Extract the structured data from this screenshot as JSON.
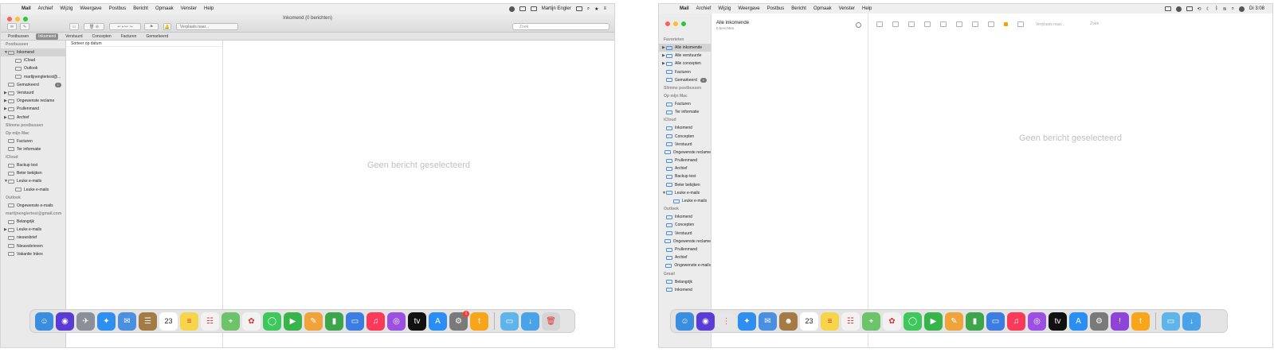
{
  "left": {
    "menubar": [
      "Mail",
      "Archief",
      "Wijzig",
      "Weergave",
      "Postbus",
      "Bericht",
      "Opmaak",
      "Venster",
      "Help"
    ],
    "user": "Martijn Engler",
    "window_title": "Inkomend (0 berichten)",
    "search_placeholder": "Zoek",
    "move_placeholder": "Verplaats naar...",
    "favorites": [
      "Postbussen",
      "Inkomend",
      "Verstuurd",
      "Concepten",
      "Facturen",
      "Gemarkeerd"
    ],
    "sort_label": "Sorteer op datum",
    "no_selection": "Geen bericht geselecteerd",
    "sidebar": [
      {
        "type": "head",
        "label": "Postbussen"
      },
      {
        "type": "row",
        "label": "Inkomend",
        "indent": 0,
        "disc": "▼",
        "selected": true
      },
      {
        "type": "row",
        "label": "iCloud",
        "indent": 1,
        "disc": ""
      },
      {
        "type": "row",
        "label": "Outlook",
        "indent": 1,
        "disc": ""
      },
      {
        "type": "row",
        "label": "martijnenglertest@...",
        "indent": 1,
        "disc": ""
      },
      {
        "type": "row",
        "label": "Gemarkeerd",
        "indent": 0,
        "disc": "",
        "badge": "1"
      },
      {
        "type": "row",
        "label": "Verstuurd",
        "indent": 0,
        "disc": "▶"
      },
      {
        "type": "row",
        "label": "Ongewenste reclame",
        "indent": 0,
        "disc": "▶"
      },
      {
        "type": "row",
        "label": "Prullenmand",
        "indent": 0,
        "disc": "▶"
      },
      {
        "type": "row",
        "label": "Archief",
        "indent": 0,
        "disc": "▶"
      },
      {
        "type": "head",
        "label": "Slimme postbussen"
      },
      {
        "type": "head",
        "label": "Op mijn Mac"
      },
      {
        "type": "row",
        "label": "Facturen",
        "indent": 0,
        "disc": ""
      },
      {
        "type": "row",
        "label": "Ter informatie",
        "indent": 0,
        "disc": ""
      },
      {
        "type": "head",
        "label": "iCloud"
      },
      {
        "type": "row",
        "label": "Backup test",
        "indent": 0,
        "disc": ""
      },
      {
        "type": "row",
        "label": "Beter bekijken",
        "indent": 0,
        "disc": ""
      },
      {
        "type": "row",
        "label": "Leuke e-mails",
        "indent": 0,
        "disc": "▼"
      },
      {
        "type": "row",
        "label": "Leuke e-mails",
        "indent": 1,
        "disc": ""
      },
      {
        "type": "head",
        "label": "Outlook"
      },
      {
        "type": "row",
        "label": "Ongewenste e-mails",
        "indent": 0,
        "disc": ""
      },
      {
        "type": "head",
        "label": "martijnenglertest@gmail.com"
      },
      {
        "type": "row",
        "label": "Belangrijk",
        "indent": 0,
        "disc": ""
      },
      {
        "type": "row",
        "label": "Leuke e-mails",
        "indent": 0,
        "disc": "▶"
      },
      {
        "type": "row",
        "label": "nieuwsbrief",
        "indent": 0,
        "disc": ""
      },
      {
        "type": "row",
        "label": "Nieuwsbrieven",
        "indent": 0,
        "disc": ""
      },
      {
        "type": "row",
        "label": "Vakantie Inbox",
        "indent": 0,
        "disc": ""
      }
    ],
    "dock": [
      {
        "name": "finder",
        "color": "#3b8de0",
        "glyph": "☺"
      },
      {
        "name": "siri",
        "color": "#5a3bd6",
        "glyph": "◉"
      },
      {
        "name": "launchpad",
        "color": "#8a8f99",
        "glyph": "✈"
      },
      {
        "name": "safari",
        "color": "#2f8ff0",
        "glyph": "✦"
      },
      {
        "name": "mail",
        "color": "#4a8fe0",
        "glyph": "✉"
      },
      {
        "name": "contacts",
        "color": "#a57b45",
        "glyph": "☰"
      },
      {
        "name": "calendar",
        "color": "#ffffff",
        "glyph": "23"
      },
      {
        "name": "notes",
        "color": "#f7d54a",
        "glyph": "≡"
      },
      {
        "name": "reminders",
        "color": "#f2f2f2",
        "glyph": "☷"
      },
      {
        "name": "maps",
        "color": "#6cc36a",
        "glyph": "⌖"
      },
      {
        "name": "photos",
        "color": "#f2f2f2",
        "glyph": "✿"
      },
      {
        "name": "messages",
        "color": "#3ec75a",
        "glyph": "◯"
      },
      {
        "name": "facetime",
        "color": "#38b54a",
        "glyph": "▶"
      },
      {
        "name": "freeform",
        "color": "#f0a33a",
        "glyph": "✎"
      },
      {
        "name": "numbers",
        "color": "#3da64b",
        "glyph": "▮"
      },
      {
        "name": "keynote",
        "color": "#3b7de0",
        "glyph": "▭"
      },
      {
        "name": "music",
        "color": "#fb3958",
        "glyph": "♫"
      },
      {
        "name": "podcasts",
        "color": "#9b4fe3",
        "glyph": "◎"
      },
      {
        "name": "tv",
        "color": "#111111",
        "glyph": "tv"
      },
      {
        "name": "app-store",
        "color": "#2a8ef5",
        "glyph": "A"
      },
      {
        "name": "system-preferences",
        "color": "#7a7a7a",
        "glyph": "⚙",
        "badge": "1"
      },
      {
        "name": "tips",
        "color": "#f9a51a",
        "glyph": "t"
      },
      {
        "name": "sep"
      },
      {
        "name": "folder-apps",
        "color": "#5fb4ea",
        "glyph": "▭"
      },
      {
        "name": "folder-downloads",
        "color": "#4aa3e8",
        "glyph": "↓"
      },
      {
        "name": "trash",
        "color": "#d5d5d5",
        "glyph": "🗑"
      }
    ]
  },
  "right": {
    "menubar": [
      "Mail",
      "Archief",
      "Wijzig",
      "Weergave",
      "Postbus",
      "Bericht",
      "Opmaak",
      "Venster",
      "Help"
    ],
    "clock": "Di 3:08",
    "list_title": "Alle inkomende",
    "list_subtitle": "0 berichten",
    "move_placeholder": "Verplaats naar...",
    "search_placeholder": "Zoek",
    "no_selection": "Geen bericht geselecteerd",
    "sidebar": [
      {
        "type": "head",
        "label": "Favorieten"
      },
      {
        "type": "row",
        "label": "Alle inkomende",
        "indent": 0,
        "disc": "▶",
        "selected": true
      },
      {
        "type": "row",
        "label": "Alle verstuurde",
        "indent": 0,
        "disc": "▶"
      },
      {
        "type": "row",
        "label": "Alle concepten",
        "indent": 0,
        "disc": "▶"
      },
      {
        "type": "row",
        "label": "Facturen",
        "indent": 0,
        "disc": ""
      },
      {
        "type": "row",
        "label": "Gemarkeerd",
        "indent": 0,
        "disc": "",
        "badge": "1"
      },
      {
        "type": "head",
        "label": "Slimme postbussen"
      },
      {
        "type": "head",
        "label": "Op mijn Mac"
      },
      {
        "type": "row",
        "label": "Facturen",
        "indent": 0,
        "disc": ""
      },
      {
        "type": "row",
        "label": "Ter informatie",
        "indent": 0,
        "disc": ""
      },
      {
        "type": "head",
        "label": "iCloud"
      },
      {
        "type": "row",
        "label": "Inkomend",
        "indent": 0,
        "disc": ""
      },
      {
        "type": "row",
        "label": "Concepten",
        "indent": 0,
        "disc": ""
      },
      {
        "type": "row",
        "label": "Verstuurd",
        "indent": 0,
        "disc": ""
      },
      {
        "type": "row",
        "label": "Ongewenste reclame",
        "indent": 0,
        "disc": ""
      },
      {
        "type": "row",
        "label": "Prullenmand",
        "indent": 0,
        "disc": ""
      },
      {
        "type": "row",
        "label": "Archief",
        "indent": 0,
        "disc": ""
      },
      {
        "type": "row",
        "label": "Backup test",
        "indent": 0,
        "disc": ""
      },
      {
        "type": "row",
        "label": "Beter bekijken",
        "indent": 0,
        "disc": ""
      },
      {
        "type": "row",
        "label": "Leuke e-mails",
        "indent": 0,
        "disc": "▼"
      },
      {
        "type": "row",
        "label": "Leuke e-mails",
        "indent": 1,
        "disc": ""
      },
      {
        "type": "head",
        "label": "Outlook"
      },
      {
        "type": "row",
        "label": "Inkomend",
        "indent": 0,
        "disc": ""
      },
      {
        "type": "row",
        "label": "Concepten",
        "indent": 0,
        "disc": ""
      },
      {
        "type": "row",
        "label": "Verstuurd",
        "indent": 0,
        "disc": ""
      },
      {
        "type": "row",
        "label": "Ongewenste reclame",
        "indent": 0,
        "disc": ""
      },
      {
        "type": "row",
        "label": "Prullenmand",
        "indent": 0,
        "disc": ""
      },
      {
        "type": "row",
        "label": "Archief",
        "indent": 0,
        "disc": ""
      },
      {
        "type": "row",
        "label": "Ongewenste e-mails",
        "indent": 0,
        "disc": ""
      },
      {
        "type": "head",
        "label": "Gmail"
      },
      {
        "type": "row",
        "label": "Belangrijk",
        "indent": 0,
        "disc": ""
      },
      {
        "type": "row",
        "label": "Inkomend",
        "indent": 0,
        "disc": ""
      }
    ],
    "dock": [
      {
        "name": "finder",
        "color": "#3b8de0",
        "glyph": "☺"
      },
      {
        "name": "siri",
        "color": "#5a3bd6",
        "glyph": "◉"
      },
      {
        "name": "launchpad",
        "color": "#e6e6e6",
        "glyph": "⋮"
      },
      {
        "name": "safari",
        "color": "#2f8ff0",
        "glyph": "✦"
      },
      {
        "name": "mail",
        "color": "#4a8fe0",
        "glyph": "✉"
      },
      {
        "name": "contacts",
        "color": "#a57b45",
        "glyph": "☻"
      },
      {
        "name": "calendar",
        "color": "#ffffff",
        "glyph": "23"
      },
      {
        "name": "notes",
        "color": "#f7d54a",
        "glyph": "≡"
      },
      {
        "name": "reminders",
        "color": "#f2f2f2",
        "glyph": "☷"
      },
      {
        "name": "maps",
        "color": "#6cc36a",
        "glyph": "⌖"
      },
      {
        "name": "photos",
        "color": "#f2f2f2",
        "glyph": "✿"
      },
      {
        "name": "messages",
        "color": "#3ec75a",
        "glyph": "◯"
      },
      {
        "name": "facetime",
        "color": "#38b54a",
        "glyph": "▶"
      },
      {
        "name": "freeform",
        "color": "#f0a33a",
        "glyph": "✎"
      },
      {
        "name": "numbers",
        "color": "#3da64b",
        "glyph": "▮"
      },
      {
        "name": "keynote",
        "color": "#3b7de0",
        "glyph": "▭"
      },
      {
        "name": "music",
        "color": "#fb3958",
        "glyph": "♫"
      },
      {
        "name": "podcasts",
        "color": "#9b4fe3",
        "glyph": "◎"
      },
      {
        "name": "tv",
        "color": "#111111",
        "glyph": "tv"
      },
      {
        "name": "app-store",
        "color": "#2a8ef5",
        "glyph": "A"
      },
      {
        "name": "system-preferences",
        "color": "#7a7a7a",
        "glyph": "⚙"
      },
      {
        "name": "feedback",
        "color": "#8e44d6",
        "glyph": "!"
      },
      {
        "name": "tips",
        "color": "#f9a51a",
        "glyph": "t"
      },
      {
        "name": "sep"
      },
      {
        "name": "folder-apps",
        "color": "#5fb4ea",
        "glyph": "▭"
      },
      {
        "name": "folder-downloads",
        "color": "#4aa3e8",
        "glyph": "↓"
      }
    ]
  }
}
